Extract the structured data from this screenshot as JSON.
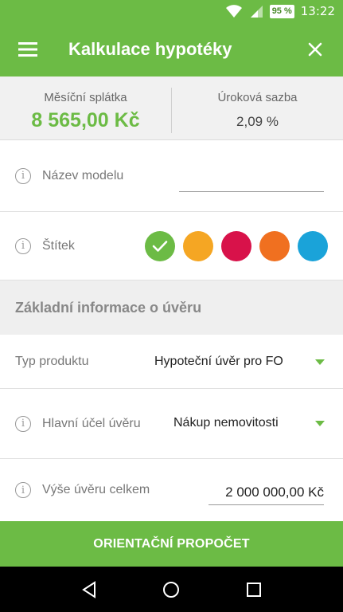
{
  "status": {
    "battery": "95 %",
    "time": "13:22"
  },
  "appbar": {
    "title": "Kalkulace hypotéky",
    "menu_icon": "menu-icon",
    "close_icon": "close-icon"
  },
  "summary": {
    "payment_label": "Měsíční splátka",
    "payment_value": "8 565,00 Kč",
    "rate_label": "Úroková sazba",
    "rate_value": "2,09 %"
  },
  "form": {
    "model_name": {
      "label": "Název modelu",
      "value": ""
    },
    "tag": {
      "label": "Štítek",
      "colors": [
        "#6cbb45",
        "#f5a623",
        "#d8124a",
        "#f07020",
        "#1aa3d9"
      ],
      "selected_index": 0
    },
    "section_title": "Základní informace o úvěru",
    "product_type": {
      "label": "Typ produktu",
      "value": "Hypoteční úvěr pro FO"
    },
    "purpose": {
      "label": "Hlavní účel úvěru",
      "value": "Nákup nemovitosti"
    },
    "amount": {
      "label": "Výše úvěru celkem",
      "value": "2 000 000,00 Kč"
    }
  },
  "cta": {
    "label": "ORIENTAČNÍ PROPOČET"
  },
  "colors": {
    "accent": "#6cbb45"
  }
}
